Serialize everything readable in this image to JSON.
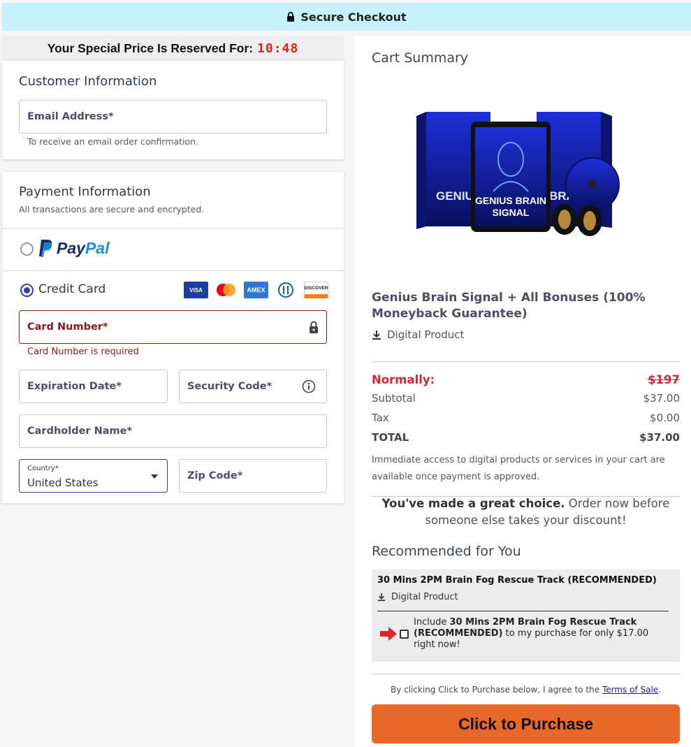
{
  "topbar": {
    "title": "Secure Checkout"
  },
  "timer": {
    "label": "Your Special Price Is Reserved For:",
    "time": "10:48"
  },
  "customer": {
    "title": "Customer Information",
    "email_placeholder": "Email Address*",
    "email_help": "To receive an email order confirmation."
  },
  "payment": {
    "title": "Payment Information",
    "subtitle": "All transactions are secure and encrypted.",
    "paypal": {
      "pay": "Pay",
      "pal": "Pal",
      "selected": false
    },
    "credit_card": {
      "label": "Credit Card",
      "selected": true
    },
    "card_logos": [
      "VISA",
      "mastercard",
      "AMEX",
      "Diners Club",
      "DISCOVER"
    ],
    "card_number_placeholder": "Card Number*",
    "card_number_error": "Card Number is required",
    "expiration_placeholder": "Expiration Date*",
    "security_placeholder": "Security Code*",
    "cardholder_placeholder": "Cardholder Name*",
    "country_label": "Country*",
    "country_value": "United States",
    "zip_placeholder": "Zip Code*"
  },
  "cart": {
    "title": "Cart Summary",
    "product_image_text": "GENIUS BRAIN SIGNAL",
    "product_title": "Genius Brain Signal + All Bonuses (100% Moneyback Guarantee)",
    "product_type": "Digital Product",
    "normally_label": "Normally:",
    "normally_value": "$197",
    "subtotal_label": "Subtotal",
    "subtotal_value": "$37.00",
    "tax_label": "Tax",
    "tax_value": "$0.00",
    "total_label": "TOTAL",
    "total_value": "$37.00",
    "note": "Immediate access to digital products or services in your cart are available once payment is approved.",
    "choice_bold": "You've made a great choice.",
    "choice_rest": " Order now before someone else takes your discount!"
  },
  "recommended": {
    "title": "Recommended for You",
    "item_title": "30 Mins 2PM Brain Fog Rescue Track (RECOMMENDED)",
    "item_type": "Digital Product",
    "offer_prefix": "Include ",
    "offer_bold": "30 Mins 2PM Brain Fog Rescue Track (RECOMMENDED)",
    "offer_suffix": " to my purchase for only $17.00 right now!",
    "checked": false
  },
  "checkout": {
    "terms_prefix": "By clicking Click to Purchase below, I agree to the ",
    "terms_link": "Terms of Sale",
    "terms_suffix": ".",
    "button_label": "Click to Purchase"
  },
  "colors": {
    "topbar": "#c7f1fb",
    "timer_digits": "#e0201c",
    "error": "#8b1a1a",
    "accent": "#3b3bb0",
    "purchase_button": "#e8682a",
    "normally": "#d6282c"
  }
}
